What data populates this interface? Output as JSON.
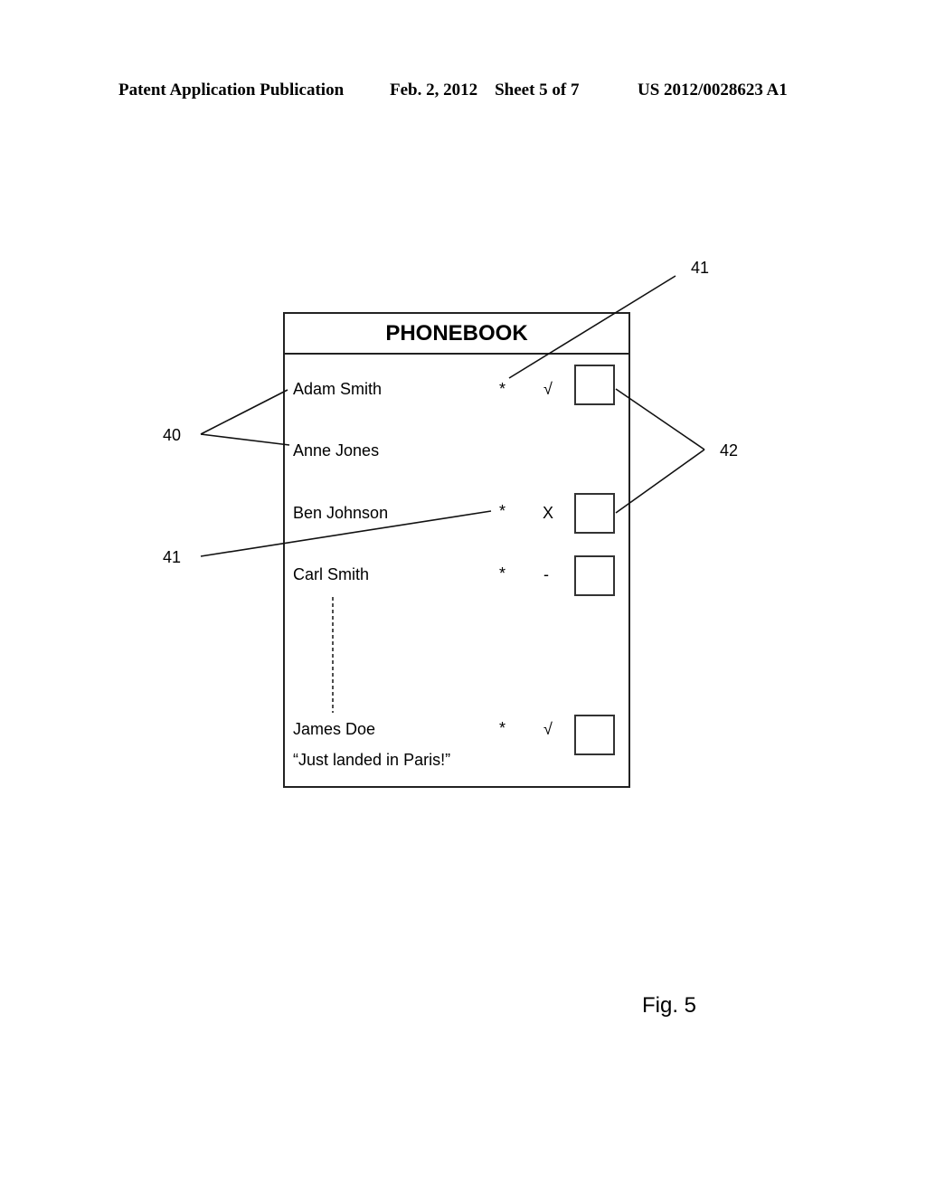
{
  "header": {
    "left": "Patent Application Publication",
    "date_sheet": "Feb. 2, 2012    Sheet 5 of 7",
    "pub_number": "US 2012/0028623 A1"
  },
  "phonebook": {
    "title": "PHONEBOOK",
    "contacts": [
      {
        "name": "Adam Smith",
        "marker": "*",
        "status": "√",
        "has_checkbox": true
      },
      {
        "name": "Anne Jones",
        "marker": "",
        "status": "",
        "has_checkbox": false
      },
      {
        "name": "Ben Johnson",
        "marker": "*",
        "status": "X",
        "has_checkbox": true
      },
      {
        "name": "Carl Smith",
        "marker": "*",
        "status": "-",
        "has_checkbox": true
      },
      {
        "name": "James Doe",
        "marker": "*",
        "status": "√",
        "has_checkbox": true,
        "message": "“Just landed in Paris!”"
      }
    ]
  },
  "references": {
    "ref_41_top": "41",
    "ref_40": "40",
    "ref_42": "42",
    "ref_41_bottom": "41"
  },
  "figure_label": "Fig. 5"
}
